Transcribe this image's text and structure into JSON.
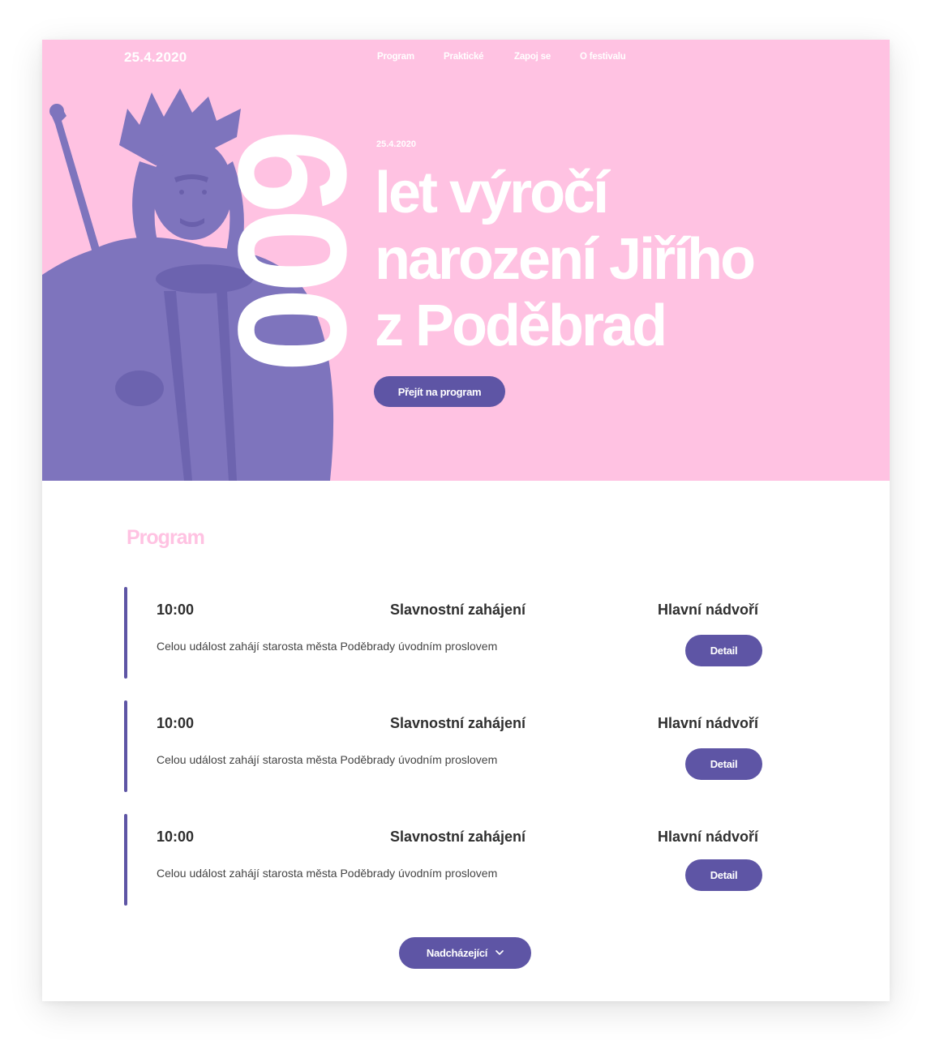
{
  "header": {
    "date": "25.4.2020",
    "nav": [
      {
        "label": "Program"
      },
      {
        "label": "Praktické"
      },
      {
        "label": "Zapoj se"
      },
      {
        "label": "O festivalu"
      }
    ]
  },
  "hero": {
    "big_number": "600",
    "date": "25.4.2020",
    "title_lines": [
      "let výročí",
      "narození Jiřího",
      "z Poděbrad"
    ],
    "cta_label": "Přejít na program"
  },
  "program": {
    "heading": "Program",
    "items": [
      {
        "time": "10:00",
        "title": "Slavnostní zahájení",
        "place": "Hlavní nádvoří",
        "description": "Celou událost zahájí starosta města Poděbrady úvodním proslovem",
        "button": "Detail"
      },
      {
        "time": "10:00",
        "title": "Slavnostní zahájení",
        "place": "Hlavní nádvoří",
        "description": "Celou událost zahájí starosta města Poděbrady úvodním proslovem",
        "button": "Detail"
      },
      {
        "time": "10:00",
        "title": "Slavnostní zahájení",
        "place": "Hlavní nádvoří",
        "description": "Celou událost zahájí starosta města Poděbrady úvodním proslovem",
        "button": "Detail"
      }
    ],
    "more_label": "Nadcházející"
  },
  "colors": {
    "hero_bg": "#ffc2e2",
    "accent": "#5e55a5",
    "portrait": "#7e74bd",
    "text_dark": "#2f2f2f"
  },
  "icons": {
    "more_chevron": "chevron-down-icon"
  }
}
